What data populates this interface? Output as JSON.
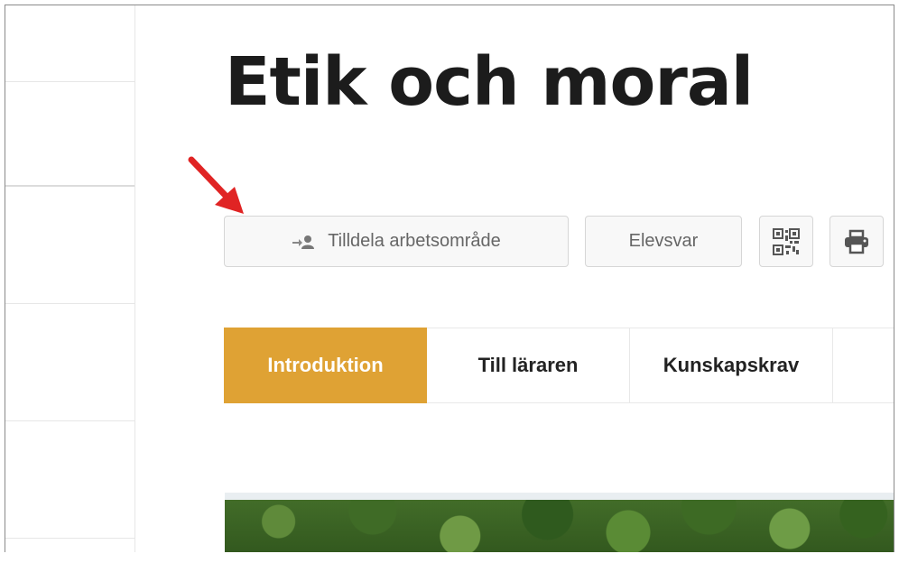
{
  "header": {
    "title": "Etik och moral"
  },
  "toolbar": {
    "assign_label": "Tilldela arbetsområde",
    "student_answers_label": "Elevsvar",
    "assign_icon": "add-user-icon",
    "qr_icon": "qr-code-icon",
    "print_icon": "printer-icon"
  },
  "tabs": [
    {
      "label": "Introduktion",
      "active": true
    },
    {
      "label": "Till läraren",
      "active": false
    },
    {
      "label": "Kunskapskrav",
      "active": false
    }
  ],
  "colors": {
    "active_tab": "#dfa234",
    "arrow": "#e02424"
  }
}
